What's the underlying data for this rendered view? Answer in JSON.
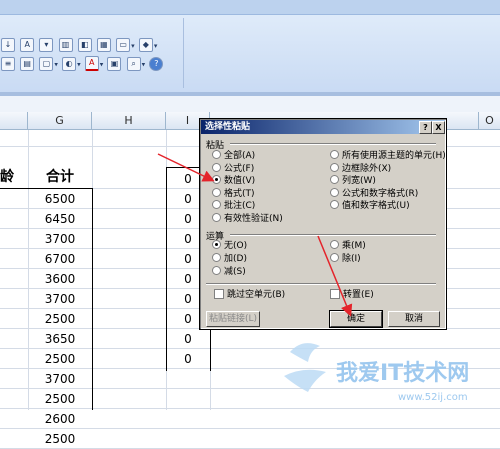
{
  "columns": {
    "g": "G",
    "h": "H",
    "i": "I",
    "o": "O"
  },
  "sheet": {
    "header_left": "龄",
    "header_total": "合计",
    "totals": [
      "6500",
      "6450",
      "3700",
      "6700",
      "3600",
      "3700",
      "2500",
      "3650",
      "2500",
      "3700",
      "2500",
      "2600",
      "2500"
    ],
    "col_i_values": [
      "0",
      "0",
      "0",
      "0",
      "0",
      "0",
      "0",
      "0",
      "0",
      "0"
    ]
  },
  "ribbon": {
    "font_color_glyph": "A"
  },
  "dialog": {
    "title": "选择性粘贴",
    "help_button": "?",
    "close_button": "X",
    "paste_group": "粘贴",
    "paste_options_left": [
      "全部(A)",
      "公式(F)",
      "数值(V)",
      "格式(T)",
      "批注(C)",
      "有效性验证(N)"
    ],
    "paste_options_right": [
      "所有使用源主题的单元(H)",
      "边框除外(X)",
      "列宽(W)",
      "公式和数字格式(R)",
      "值和数字格式(U)"
    ],
    "selected_paste": "数值(V)",
    "operation_group": "运算",
    "operation_left": [
      "无(O)",
      "加(D)",
      "减(S)"
    ],
    "operation_right": [
      "乘(M)",
      "除(I)"
    ],
    "selected_operation": "无(O)",
    "skip_blanks": "跳过空单元(B)",
    "transpose": "转置(E)",
    "paste_link": "粘贴链接(L)",
    "ok": "确定",
    "cancel": "取消"
  },
  "watermark": {
    "text": "我爱IT技术网",
    "url": "www.52ij.com"
  },
  "colors": {
    "title_start": "#0a246a",
    "title_end": "#a6caf0",
    "arrow": "#e4242b",
    "watermark": "#9ec9ef"
  }
}
